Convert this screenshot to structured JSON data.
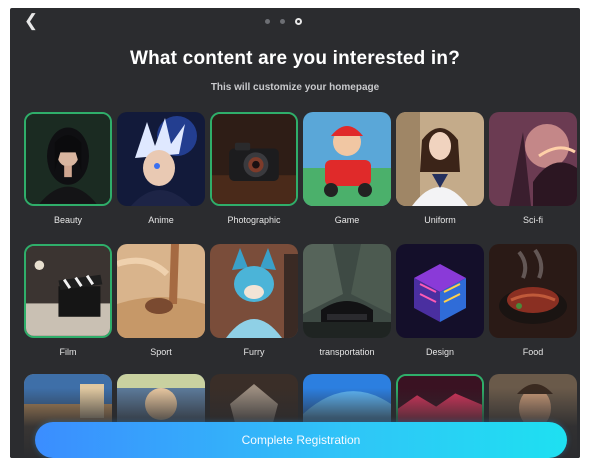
{
  "header": {
    "back_icon": "chevron-left-icon",
    "step_indicator": {
      "total": 3,
      "current": 3
    },
    "title": "What content are you interested in?",
    "subtitle": "This will customize your homepage"
  },
  "categories": [
    {
      "label": "Beauty",
      "selected": true
    },
    {
      "label": "Anime",
      "selected": false
    },
    {
      "label": "Photographic",
      "selected": true
    },
    {
      "label": "Game",
      "selected": false
    },
    {
      "label": "Uniform",
      "selected": false
    },
    {
      "label": "Sci-fi",
      "selected": false
    },
    {
      "label": "Film",
      "selected": true
    },
    {
      "label": "Sport",
      "selected": false
    },
    {
      "label": "Furry",
      "selected": false
    },
    {
      "label": "transportation",
      "selected": false
    },
    {
      "label": "Design",
      "selected": false
    },
    {
      "label": "Food",
      "selected": false
    },
    {
      "label": "",
      "selected": false
    },
    {
      "label": "",
      "selected": false
    },
    {
      "label": "",
      "selected": false
    },
    {
      "label": "",
      "selected": false
    },
    {
      "label": "",
      "selected": true
    },
    {
      "label": "",
      "selected": false
    }
  ],
  "footer": {
    "cta_label": "Complete Registration"
  },
  "colors": {
    "background": "#2b2c2f",
    "selected_border": "#2fae6a",
    "cta_start": "#3b8dff",
    "cta_end": "#1ee0f1"
  }
}
